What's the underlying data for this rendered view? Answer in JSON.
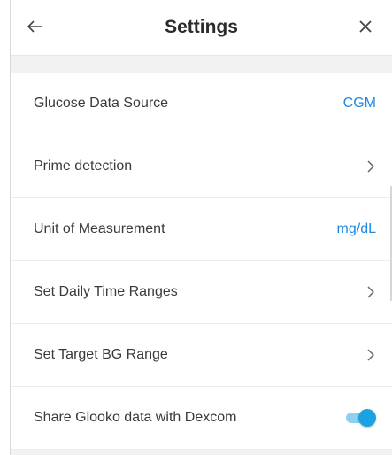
{
  "header": {
    "title": "Settings",
    "back_icon": "arrow-left-icon",
    "close_icon": "close-icon"
  },
  "settings": [
    {
      "label": "Glucose Data Source",
      "value": "CGM",
      "type": "value"
    },
    {
      "label": "Prime detection",
      "type": "chevron"
    },
    {
      "label": "Unit of Measurement",
      "value": "mg/dL",
      "type": "value"
    },
    {
      "label": "Set Daily Time Ranges",
      "type": "chevron"
    },
    {
      "label": "Set Target BG Range",
      "type": "chevron"
    },
    {
      "label": "Share Glooko data with Dexcom",
      "type": "toggle",
      "enabled": true
    }
  ],
  "colors": {
    "accent": "#1e88e5",
    "toggle_on": "#1aa3e0",
    "toggle_track": "#8fd0ef",
    "section_bg": "#f2f2f2"
  }
}
